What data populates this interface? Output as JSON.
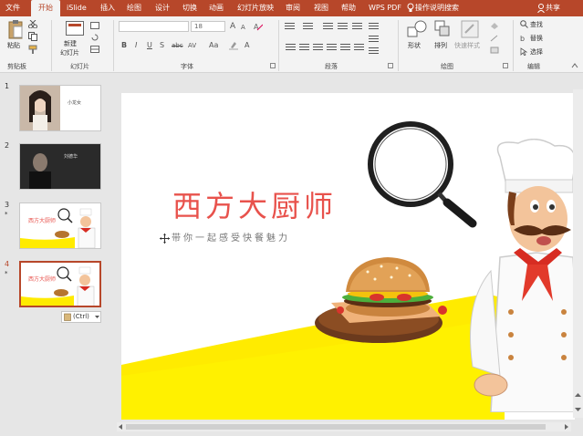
{
  "menubar": {
    "tabs": [
      "文件",
      "开始",
      "iSlide",
      "插入",
      "绘图",
      "设计",
      "切换",
      "动画",
      "幻灯片放映",
      "审阅",
      "视图",
      "帮助",
      "WPS PDF"
    ],
    "active_tab": "开始",
    "search_label": "操作说明搜索",
    "share_label": "共享"
  },
  "ribbon": {
    "clipboard": {
      "paste": "粘贴",
      "label": "剪贴板"
    },
    "slides": {
      "new_slide_line1": "新建",
      "new_slide_line2": "幻灯片",
      "label": "幻灯片"
    },
    "font": {
      "size_value": "18",
      "label": "字体",
      "bold": "B",
      "italic": "I",
      "underline": "U",
      "shadow": "S",
      "strike": "abc",
      "spacing": "AV",
      "case": "Aa",
      "grow": "A",
      "shrink": "A"
    },
    "paragraph": {
      "label": "段落"
    },
    "drawing": {
      "shape": "形状",
      "arrange": "排列",
      "quick_style": "快速样式",
      "label": "绘图"
    },
    "editing": {
      "find": "查找",
      "replace": "替换",
      "select": "选择",
      "label": "编辑"
    }
  },
  "thumbnails": [
    {
      "number": "1",
      "star": "",
      "caption": "小龙女"
    },
    {
      "number": "2",
      "star": "",
      "caption": "刘德华"
    },
    {
      "number": "3",
      "star": "*",
      "caption": "西方大厨师"
    },
    {
      "number": "4",
      "star": "*",
      "caption": "西方大厨师"
    }
  ],
  "paste_options": "(Ctrl)",
  "slide": {
    "title": "西方大厨师",
    "subtitle": "带你一起感受快餐魅力"
  },
  "colors": {
    "accent": "#b7472a",
    "title_red": "#e8524c",
    "yellow": "#ffeb00"
  }
}
